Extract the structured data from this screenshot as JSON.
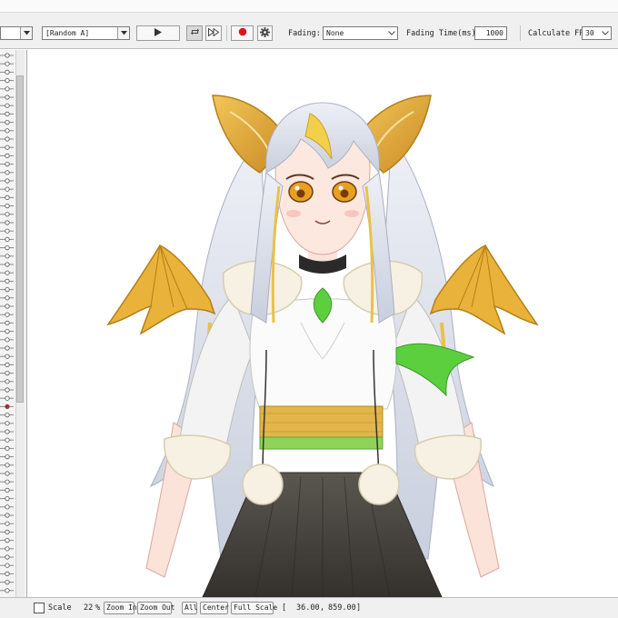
{
  "toolbar": {
    "motion_select_value": "",
    "random_select_value": "[Random A]",
    "fading_label": "Fading:",
    "fading_value": "None",
    "fading_time_label": "Fading Time(ms):",
    "fading_time_value": "1000",
    "calc_fps_label": "Calculate FPS",
    "calc_fps_value": "30"
  },
  "statusbar": {
    "scale_label": "Scale",
    "zoom_value": "22",
    "zoom_unit": "%",
    "zoom_in_label": "Zoom In",
    "zoom_out_label": "Zoom Out",
    "all_label": "All",
    "center_label": "Center",
    "full_scale_label": "Full Scale",
    "coord_open": "[",
    "coord_x": "36.00",
    "coord_sep": ",",
    "coord_y": "859.00",
    "coord_close": "]"
  },
  "colors": {
    "record": "#e0141b",
    "ribbon_green": "#5ccf3f",
    "wing_gold": "#e9b23a",
    "skirt": "#4a4641"
  },
  "icons": [
    "chevron-down-icon",
    "play-icon",
    "loop-icon",
    "fast-forward-icon",
    "record-icon",
    "gear-icon"
  ]
}
